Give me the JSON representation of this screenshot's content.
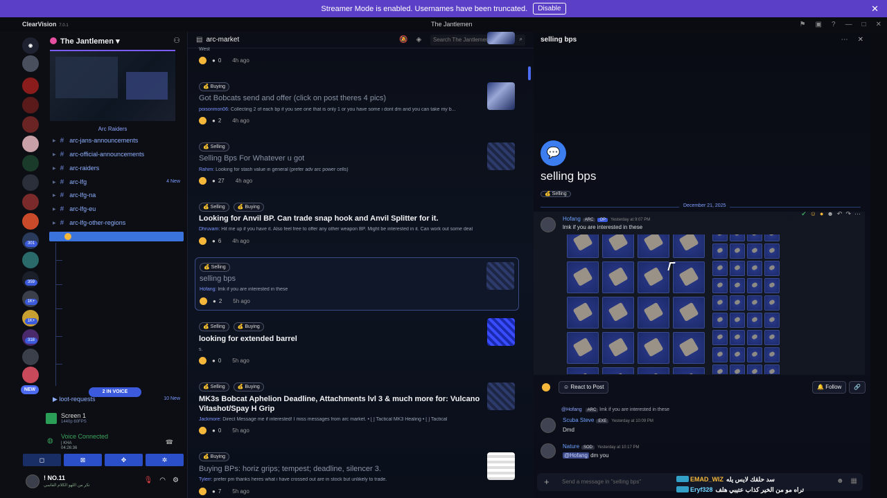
{
  "banner": {
    "text": "Streamer Mode is enabled. Usernames have been truncated.",
    "button": "Disable"
  },
  "titlebar": {
    "app": "ClearVision",
    "version": "7.0.1",
    "server": "The Jantlemen"
  },
  "rail": {
    "badges": [
      "301",
      "359",
      "1K+",
      "1K+",
      "318"
    ],
    "new_label": "NEW"
  },
  "sidebar": {
    "guild_name": "The Jantlemen",
    "section": "Arc Raiders",
    "channels": [
      {
        "label": "arc-jans-announcements",
        "new": ""
      },
      {
        "label": "arc-official-announcements",
        "new": ""
      },
      {
        "label": "arc-raiders",
        "new": ""
      },
      {
        "label": "arc-lfg",
        "new": "4 New"
      },
      {
        "label": "arc-lfg-na",
        "new": ""
      },
      {
        "label": "arc-lfg-eu",
        "new": ""
      },
      {
        "label": "arc-lfg-other-regions",
        "new": ""
      }
    ],
    "in_voice": "2 IN VOICE",
    "loot_channel": "loot-requests",
    "loot_new": "10 New",
    "screen": {
      "title": "Screen 1",
      "sub": "1440p 60FPS"
    },
    "voice": {
      "status": "Voice Connected",
      "line2": "| KHA",
      "line3": "04:26:36"
    },
    "user": {
      "name": "! NO.11",
      "status": "تكر من اللهو الكلام القاسي"
    }
  },
  "forum": {
    "channel": "arc-market",
    "search_placeholder": "Search The Jantlemen",
    "posts": [
      {
        "tags": [],
        "title": "",
        "author": "West",
        "preview": "",
        "replies": "0",
        "ago": "4h ago"
      },
      {
        "tags": [
          "Buying"
        ],
        "title": "Got Bobcats send and offer (click on post theres 4 pics)",
        "author": "poisonmon06:",
        "preview": " Collecting 2 of each bp if you see one that is only 1 or you have some i dont dm and you can take my b...",
        "replies": "2",
        "ago": "4h ago"
      },
      {
        "tags": [
          "Selling"
        ],
        "title": "Selling Bps For Whatever u got",
        "author": "Rahim:",
        "preview": " Looking for stash value in general (prefer adv arc power cells)",
        "replies": "27",
        "ago": "4h ago"
      },
      {
        "tags": [
          "Selling",
          "Buying"
        ],
        "title": "Looking for Anvil BP. Can trade snap hook and Anvil Splitter for it.",
        "author": "Dhruvam:",
        "preview": " Hit me up if you have it. Also feel free to offer any other weapon BP. Might be interested in it. Can work out some deal",
        "replies": "6",
        "ago": "4h ago"
      },
      {
        "tags": [
          "Selling"
        ],
        "title": "selling bps",
        "author": "Hofang:",
        "preview": " lmk if you are interested in these",
        "replies": "2",
        "ago": "5h ago"
      },
      {
        "tags": [
          "Selling",
          "Buying"
        ],
        "title": "looking for extended barrel",
        "author": "",
        "preview": "s.",
        "replies": "0",
        "ago": "5h ago"
      },
      {
        "tags": [
          "Selling",
          "Buying"
        ],
        "title": "MK3s Bobcat Aphelion Deadline, Attachments lvl 3 & much more for: Vulcano",
        "title2": "Vitashot/Spay H Grip",
        "author": "Jackmore:",
        "preview": " Direct Message me if interested! I miss messages from arc market. • [ ] Tactical MK3 Healing  • [ ] Tactical",
        "replies": "0",
        "ago": "5h ago"
      },
      {
        "tags": [
          "Buying"
        ],
        "title": "Buying BPs: horiz grips; tempest; deadline, silencer 3.",
        "author": "Tylerr:",
        "preview": " prefer pm thanks heres what i have crossed out are in stock but unlikely to trade.",
        "replies": "7",
        "ago": "5h ago"
      }
    ]
  },
  "thread": {
    "title": "selling bps",
    "tag": "Selling",
    "date": "December 21, 2025",
    "op": {
      "name": "Hofang",
      "badge": "ARC",
      "op": "OP",
      "time": "Yesterday at 9:07 PM",
      "text": "lmk if you are interested in these"
    },
    "react_label": "React to Post",
    "follow_label": "Follow",
    "reply_ref": {
      "name": "@Hofang",
      "badge": "ARC",
      "text": "lmk if you are interested in these"
    },
    "replies": [
      {
        "name": "Scuba Steve",
        "badge": "EXE",
        "time": "Yesterday at 10:09 PM",
        "text": "Dmd"
      },
      {
        "name": "Nature",
        "badge": "SOD",
        "time": "Yesterday at 10:17 PM",
        "text": "dm you",
        "mention": "@Hofang"
      }
    ],
    "composer_placeholder": "Send a message in \"selling bps\""
  },
  "overlay": [
    {
      "name": "EMAD_WIZ",
      "text": "سد حلقك لايس يله"
    },
    {
      "name": "Eryf328",
      "text": "تراه مو من الخير كذاب عتيبي هلف"
    }
  ]
}
